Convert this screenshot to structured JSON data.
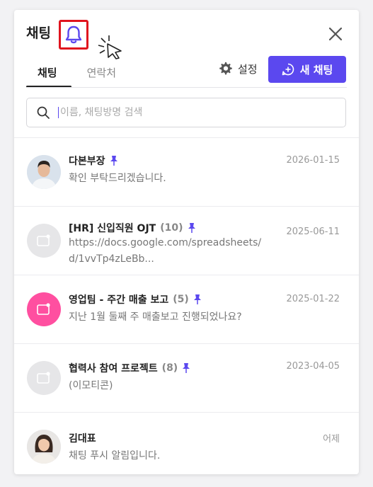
{
  "header": {
    "title": "채팅",
    "bell_icon": "bell-icon",
    "close_icon": "close-icon"
  },
  "tabs": [
    {
      "label": "채팅",
      "active": true
    },
    {
      "label": "연락처",
      "active": false
    }
  ],
  "settings_label": "설정",
  "new_chat_label": "새 채팅",
  "search": {
    "placeholder": "이름, 채팅방명 검색",
    "value": ""
  },
  "accent_color": "#5b48ef",
  "highlight_color": "#e0141e",
  "chats": [
    {
      "name": "다본부장",
      "count": "",
      "pinned": true,
      "preview": "확인 부탁드리겠습니다.",
      "date": "2026-01-15",
      "avatar": "photo-man"
    },
    {
      "name": "[HR] 신입직원 OJT",
      "count": "(10)",
      "pinned": true,
      "preview": "https://docs.google.com/spreadsheets/d/1vvTp4zLeBb...",
      "date": "2025-06-11",
      "avatar": "group-gray"
    },
    {
      "name": "영업팀 - 주간 매출 보고",
      "count": "(5)",
      "pinned": true,
      "preview": "지난 1월 둘째 주 매출보고 진행되었나요?",
      "date": "2025-01-22",
      "avatar": "group-pink"
    },
    {
      "name": "협력사 참여 프로젝트",
      "count": "(8)",
      "pinned": true,
      "preview": "(이모티콘)",
      "date": "2023-04-05",
      "avatar": "group-gray"
    },
    {
      "name": "김대표",
      "count": "",
      "pinned": false,
      "preview": "채팅 푸시 알림입니다.",
      "date": "어제",
      "avatar": "photo-woman"
    }
  ]
}
